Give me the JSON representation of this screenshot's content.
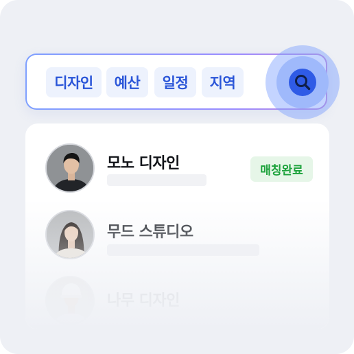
{
  "search": {
    "chips": [
      {
        "label": "디자인"
      },
      {
        "label": "예산"
      },
      {
        "label": "일정"
      },
      {
        "label": "지역"
      }
    ],
    "button_icon": "search-icon"
  },
  "results": [
    {
      "name": "모노 디자인",
      "badge": "매칭완료",
      "faded": false
    },
    {
      "name": "무드 스튜디오",
      "badge": "",
      "faded": false
    },
    {
      "name": "나무 디자인",
      "badge": "",
      "faded": true
    }
  ],
  "colors": {
    "accent": "#2f5be6",
    "chip_bg": "#edf2fd",
    "chip_text": "#2a55d8",
    "badge_bg": "#e6f6e8",
    "badge_text": "#1ca23b",
    "background": "#eef0f5"
  }
}
